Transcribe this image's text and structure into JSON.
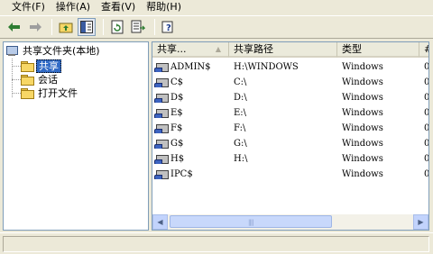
{
  "menu": [
    "文件(F)",
    "操作(A)",
    "查看(V)",
    "帮助(H)"
  ],
  "toolbar": {
    "icons": [
      "back-arrow-icon",
      "forward-arrow-icon",
      "up-folder-icon",
      "show-hide-tree-icon",
      "refresh-icon",
      "export-list-icon",
      "help-icon"
    ]
  },
  "tree": {
    "root": "共享文件夹(本地)",
    "children": [
      "共享",
      "会话",
      "打开文件"
    ],
    "selected": "共享"
  },
  "list": {
    "columns": [
      "共享...",
      "共享路径",
      "类型",
      "#"
    ],
    "rows": [
      {
        "name": "ADMIN$",
        "path": "H:\\WINDOWS",
        "type": "Windows",
        "count": "0"
      },
      {
        "name": "C$",
        "path": "C:\\",
        "type": "Windows",
        "count": "0"
      },
      {
        "name": "D$",
        "path": "D:\\",
        "type": "Windows",
        "count": "0"
      },
      {
        "name": "E$",
        "path": "E:\\",
        "type": "Windows",
        "count": "0"
      },
      {
        "name": "F$",
        "path": "F:\\",
        "type": "Windows",
        "count": "0"
      },
      {
        "name": "G$",
        "path": "G:\\",
        "type": "Windows",
        "count": "0"
      },
      {
        "name": "H$",
        "path": "H:\\",
        "type": "Windows",
        "count": "0"
      },
      {
        "name": "IPC$",
        "path": "",
        "type": "Windows",
        "count": "0"
      }
    ]
  }
}
